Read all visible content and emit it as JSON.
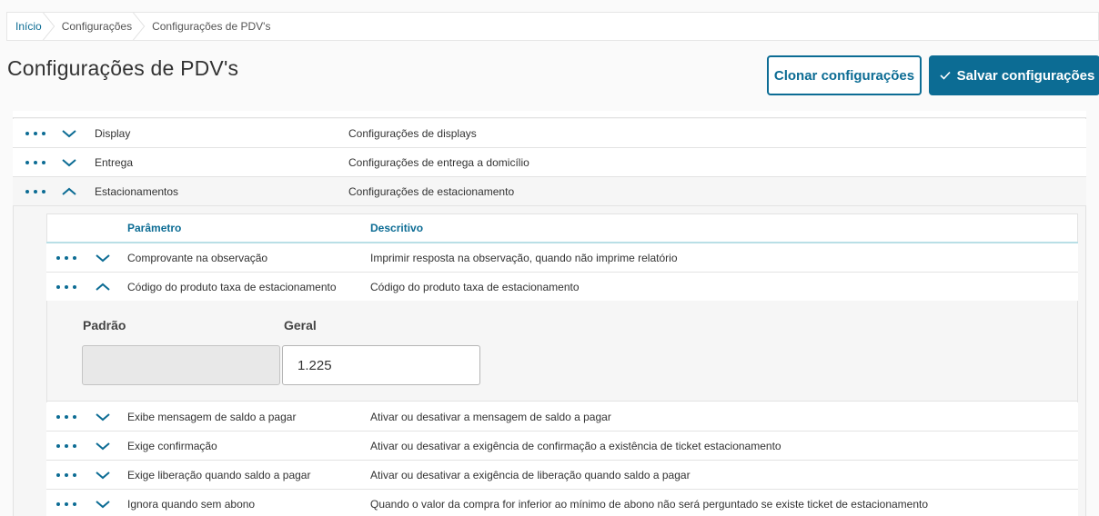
{
  "breadcrumb": {
    "items": [
      "Início",
      "Configurações",
      "Configurações de PDV's"
    ]
  },
  "header": {
    "title": "Configurações de PDV's",
    "clone_label": "Clonar configurações",
    "save_label": "Salvar configurações",
    "save_icon": "check-icon"
  },
  "colors": {
    "accent": "#0c6c94",
    "border": "#e3e3e3",
    "header_underline": "#b9dfe6"
  },
  "groups": [
    {
      "name": "Display",
      "description": "Configurações de displays",
      "expanded": false
    },
    {
      "name": "Entrega",
      "description": "Configurações de entrega a domicílio",
      "expanded": false
    },
    {
      "name": "Estacionamentos",
      "description": "Configurações de estacionamento",
      "expanded": true
    }
  ],
  "parameters": {
    "columns": {
      "parameter": "Parâmetro",
      "description": "Descritivo"
    },
    "rows": [
      {
        "name": "Comprovante na observação",
        "description": "Imprimir resposta na observação, quando não imprime relatório",
        "expanded": false
      },
      {
        "name": "Código do produto taxa de estacionamento",
        "description": "Código do produto taxa de estacionamento",
        "expanded": true
      },
      {
        "name": "Exibe mensagem de saldo a pagar",
        "description": "Ativar ou desativar a mensagem de saldo a pagar",
        "expanded": false
      },
      {
        "name": "Exige confirmação",
        "description": "Ativar ou desativar a exigência de confirmação a existência de ticket estacionamento",
        "expanded": false
      },
      {
        "name": "Exige liberação quando saldo a pagar",
        "description": "Ativar ou desativar a exigência de liberação quando saldo a pagar",
        "expanded": false
      },
      {
        "name": "Ignora quando sem abono",
        "description": "Quando o valor da compra for inferior ao mínimo de abono não será perguntado se existe ticket de estacionamento",
        "expanded": false
      }
    ],
    "detail": {
      "default_label": "Padrão",
      "default_value": "",
      "general_label": "Geral",
      "general_value": "1.225"
    }
  }
}
